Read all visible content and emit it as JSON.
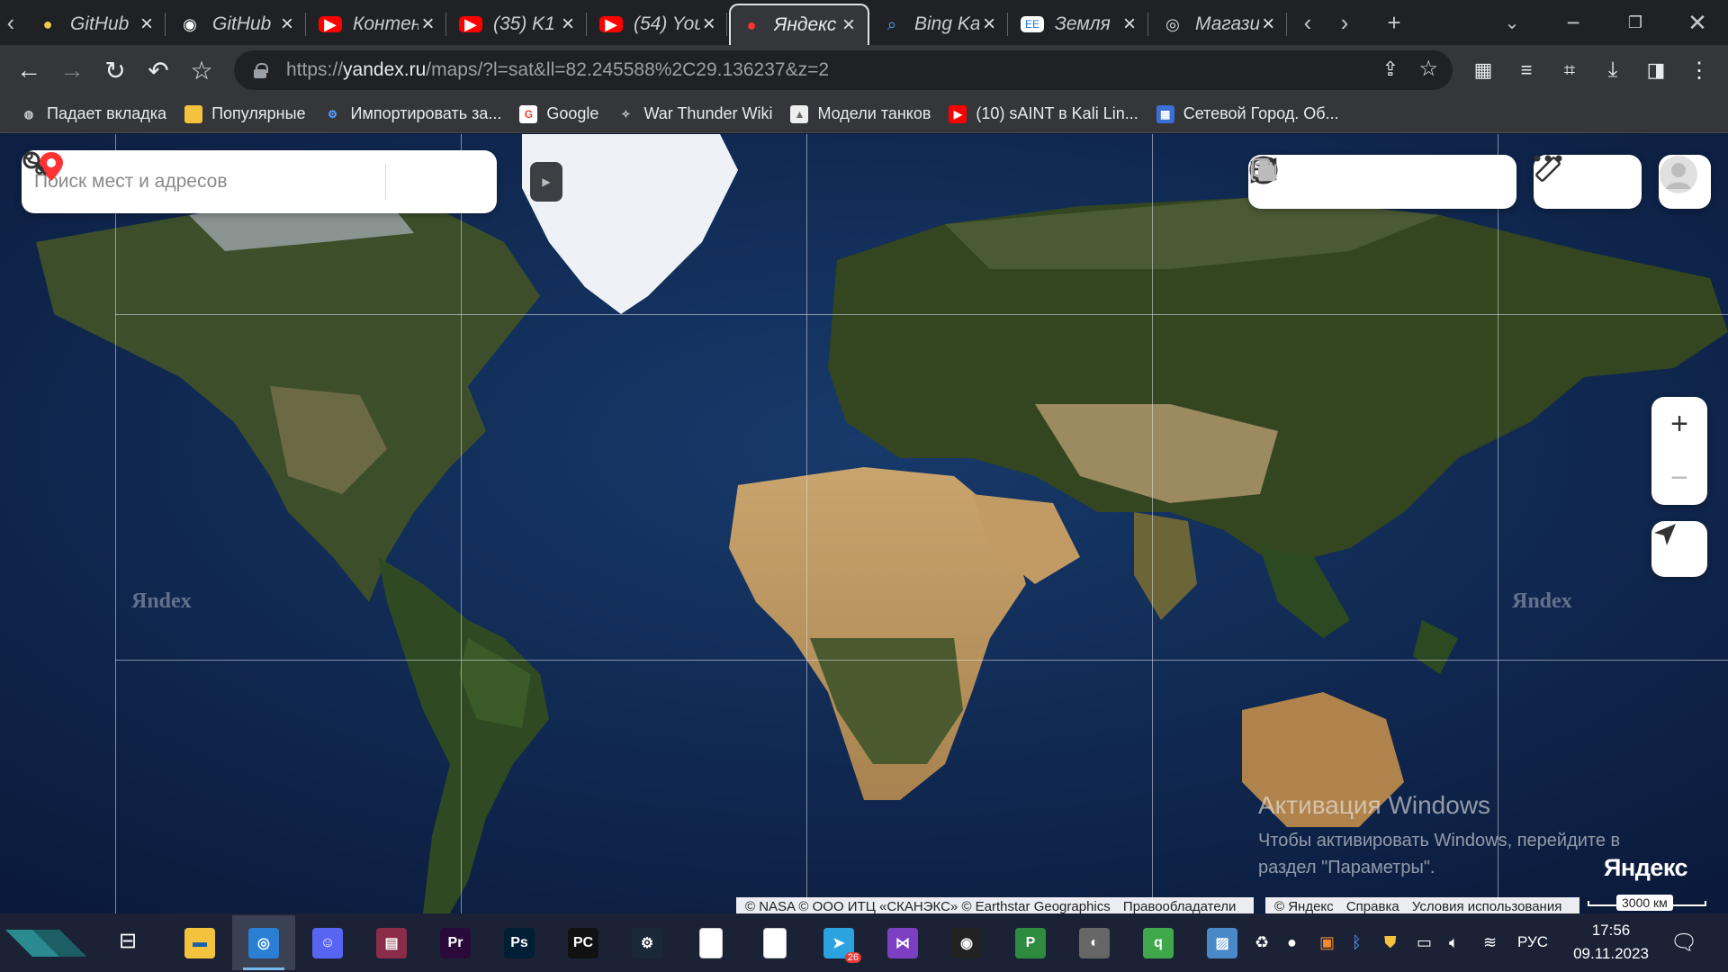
{
  "browser": {
    "tabs": [
      {
        "title": "GitHub",
        "icon": "chrome-logo-icon"
      },
      {
        "title": "GitHub",
        "icon": "github-icon"
      },
      {
        "title": "Контен",
        "icon": "youtube-icon"
      },
      {
        "title": "(35) K1",
        "icon": "youtube-icon"
      },
      {
        "title": "(54) You",
        "icon": "youtube-icon"
      },
      {
        "title": "Яндекс",
        "icon": "yandex-maps-pin-icon",
        "active": true
      },
      {
        "title": "Bing Ka",
        "icon": "bing-search-icon"
      },
      {
        "title": "Земля",
        "icon": "earth-ee-icon"
      },
      {
        "title": "Магази",
        "icon": "store-icon"
      }
    ],
    "url_host": "yandex.ru",
    "url_prefix": "https://",
    "url_path": "/maps/?l=sat&ll=82.245588%2C29.136237&z=2",
    "bookmarks": [
      {
        "label": "Падает вкладка",
        "icon": "globe-icon"
      },
      {
        "label": "Популярные",
        "icon": "folder-icon"
      },
      {
        "label": "Импортировать за...",
        "icon": "gear-icon"
      },
      {
        "label": "Google",
        "icon": "google-icon"
      },
      {
        "label": "War Thunder Wiki",
        "icon": "war-thunder-icon"
      },
      {
        "label": "Модели танков",
        "icon": "tank-icon"
      },
      {
        "label": "(10) sAINT в Kali Lin...",
        "icon": "youtube-icon"
      },
      {
        "label": "Сетевой Город. Об...",
        "icon": "school-icon"
      }
    ]
  },
  "map": {
    "search_placeholder": "Поиск мест и адресов",
    "watermark": "Яndex",
    "scale_label": "3000 км",
    "copyright_left": [
      "© NASA © ООО ИТЦ «СКАНЭКС» © Earthstar Geographics",
      "Правообладатели"
    ],
    "copyright_right": [
      "© Яндекс",
      "Справка",
      "Условия использования"
    ],
    "logo": "Яндекс",
    "zoom_in": "+",
    "zoom_out": "−",
    "layers": [
      "layers-globe-icon",
      "map-book-icon",
      "camera-icon",
      "bus-icon",
      "overlay-squares-icon"
    ],
    "tools": [
      "ruler-icon",
      "more-dots-icon"
    ]
  },
  "activation": {
    "heading": "Активация Windows",
    "line1": "Чтобы активировать Windows, перейдите в",
    "line2": "раздел \"Параметры\"."
  },
  "taskbar": {
    "apps": [
      {
        "name": "file-explorer-icon",
        "color": "#f3c33e"
      },
      {
        "name": "chrome-icon",
        "color": "#2a7fd4",
        "active": true
      },
      {
        "name": "discord-icon",
        "color": "#5865f2"
      },
      {
        "name": "winrar-icon",
        "color": "#8a2c4a"
      },
      {
        "name": "premiere-icon",
        "label": "Pr",
        "color": "#2a0a3a"
      },
      {
        "name": "photoshop-icon",
        "label": "Ps",
        "color": "#001e36"
      },
      {
        "name": "pycharm-icon",
        "label": "PC",
        "color": "#111"
      },
      {
        "name": "steam-icon",
        "color": "#1b2838"
      },
      {
        "name": "document-icon",
        "color": "#ffffff"
      },
      {
        "name": "document-icon",
        "color": "#ffffff"
      },
      {
        "name": "telegram-icon",
        "color": "#2aa3e0",
        "badge": "26"
      },
      {
        "name": "visual-studio-icon",
        "color": "#7c3fc3"
      },
      {
        "name": "obs-icon",
        "color": "#222"
      },
      {
        "name": "project-icon",
        "label": "P",
        "color": "#2d8a3e"
      },
      {
        "name": "pro-disk-icon",
        "color": "#666"
      },
      {
        "name": "qbittorrent-icon",
        "color": "#3fa84a"
      },
      {
        "name": "image-viewer-icon",
        "color": "#4a89c7"
      }
    ],
    "language": "РУС",
    "time": "17:56",
    "date": "09.11.2023"
  }
}
